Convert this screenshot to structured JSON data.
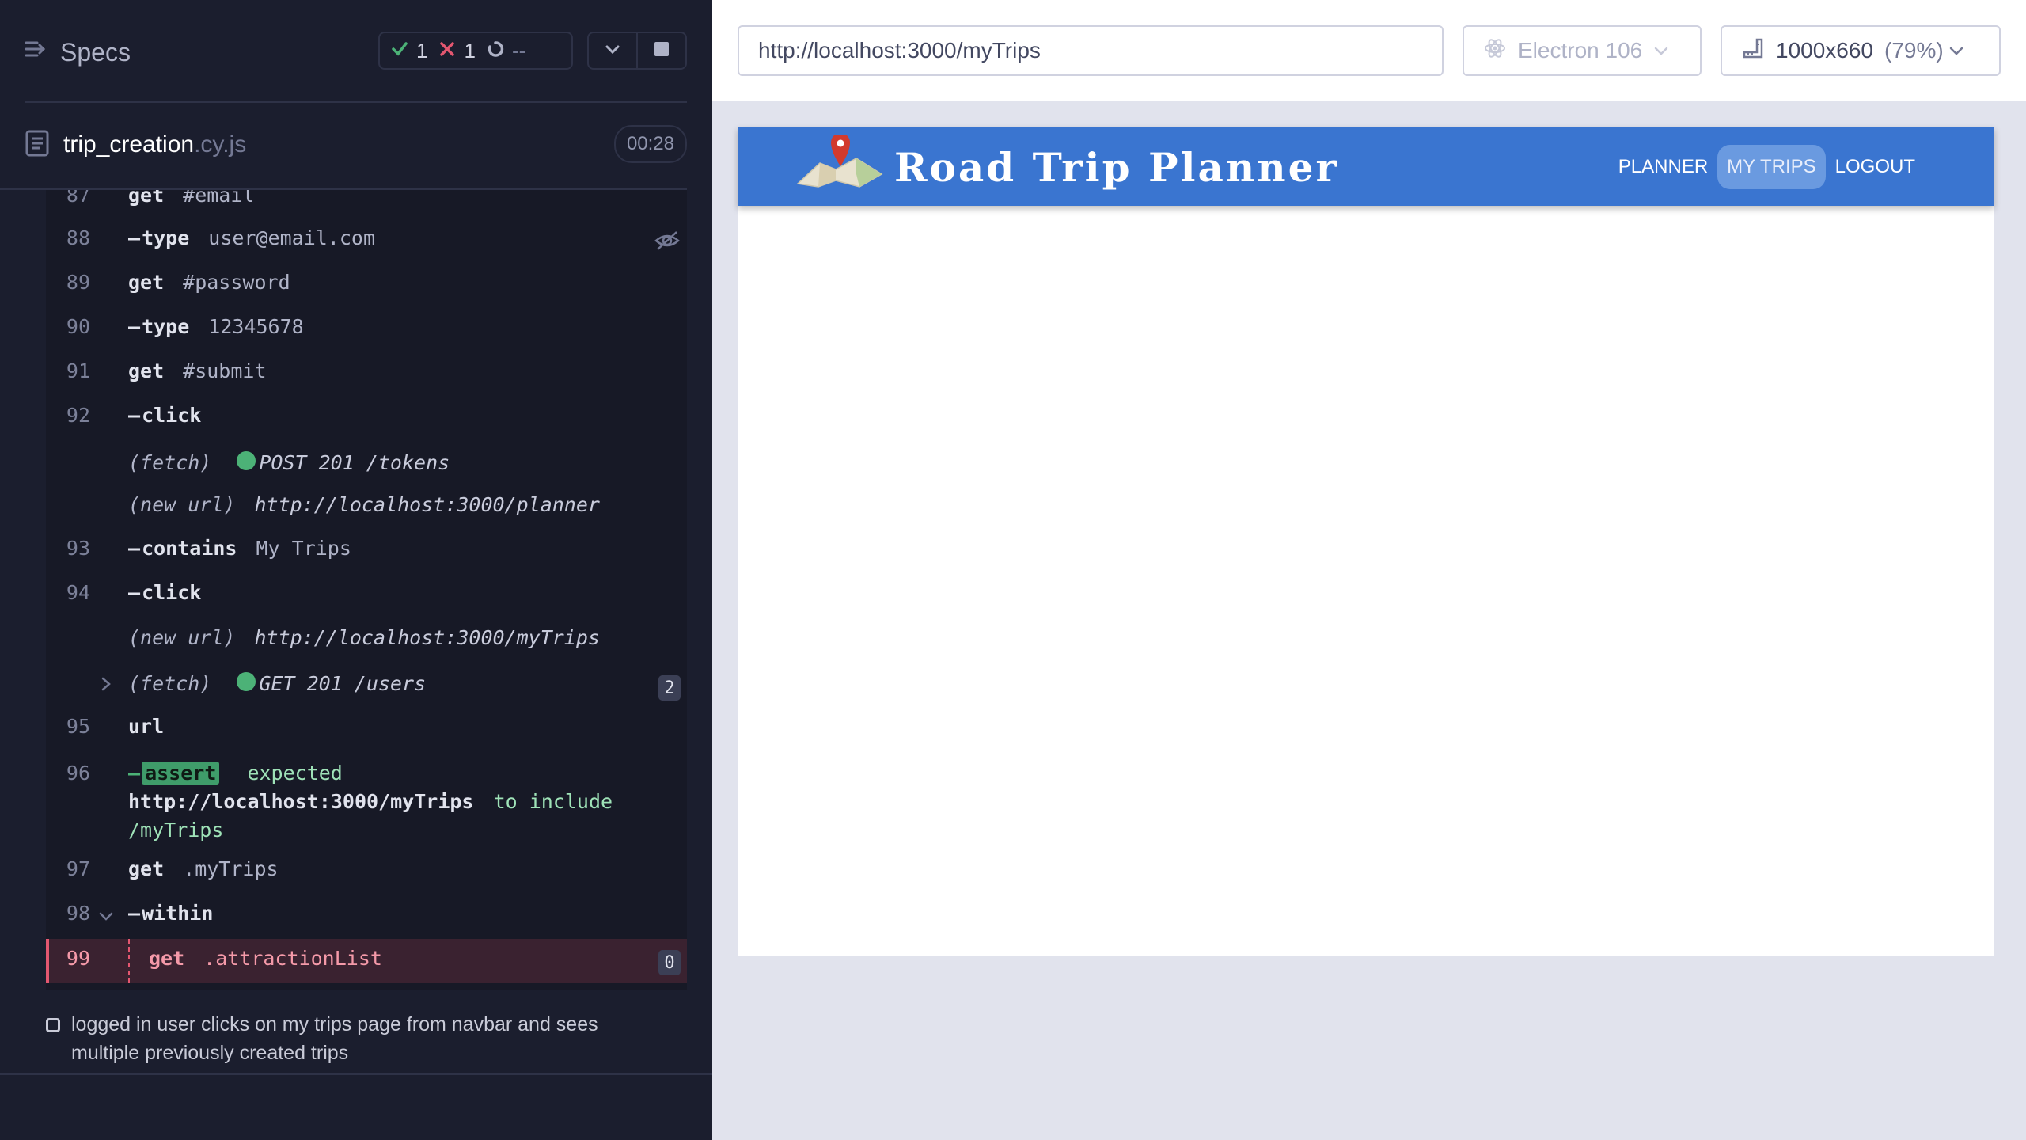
{
  "reporter": {
    "specs_label": "Specs",
    "stats": {
      "passed": "1",
      "failed": "1",
      "pending": "--"
    },
    "spec": {
      "name": "trip_creation",
      "ext": ".cy.js",
      "duration": "00:28"
    },
    "commands": [
      {
        "num": "87",
        "name": "get",
        "msg": "#email"
      },
      {
        "num": "88",
        "name": "type",
        "msg": "user@email.com"
      },
      {
        "num": "89",
        "name": "get",
        "msg": "#password"
      },
      {
        "num": "90",
        "name": "type",
        "msg": "12345678"
      },
      {
        "num": "91",
        "name": "get",
        "msg": "#submit"
      },
      {
        "num": "92",
        "name": "click",
        "msg": ""
      },
      {
        "event": "(fetch)",
        "msg": "POST 201 /tokens"
      },
      {
        "event": "(new url)",
        "msg": "http://localhost:3000/planner"
      },
      {
        "num": "93",
        "name": "contains",
        "msg": "My Trips"
      },
      {
        "num": "94",
        "name": "click",
        "msg": ""
      },
      {
        "event": "(new url)",
        "msg": "http://localhost:3000/myTrips"
      },
      {
        "event": "(fetch)",
        "msg": "GET 201 /users",
        "badge": "2"
      },
      {
        "num": "95",
        "name": "url",
        "msg": ""
      },
      {
        "num": "96",
        "name": "assert",
        "msg_parts": [
          "expected",
          "http://localhost:3000/myTrips",
          "to include",
          "/myTrips"
        ]
      },
      {
        "num": "97",
        "name": "get",
        "msg": ".myTrips"
      },
      {
        "num": "98",
        "name": "within",
        "msg": ""
      },
      {
        "num": "99",
        "name": "get",
        "msg": ".attractionList",
        "badge": "0"
      }
    ],
    "test_title": "logged in user clicks on my trips page from navbar and sees multiple previously created trips"
  },
  "topbar": {
    "url": "http://localhost:3000/myTrips",
    "browser": "Electron 106",
    "viewport": "1000x660",
    "scale": "(79%)"
  },
  "app": {
    "title": "Road Trip Planner",
    "nav": [
      "PLANNER",
      "MY TRIPS",
      "LOGOUT"
    ],
    "active_nav": "MY TRIPS"
  },
  "colors": {
    "reporter_bg": "#1b1e2e",
    "pass": "#4cb277",
    "fail": "#e45770",
    "app_nav": "#3a75d0"
  }
}
